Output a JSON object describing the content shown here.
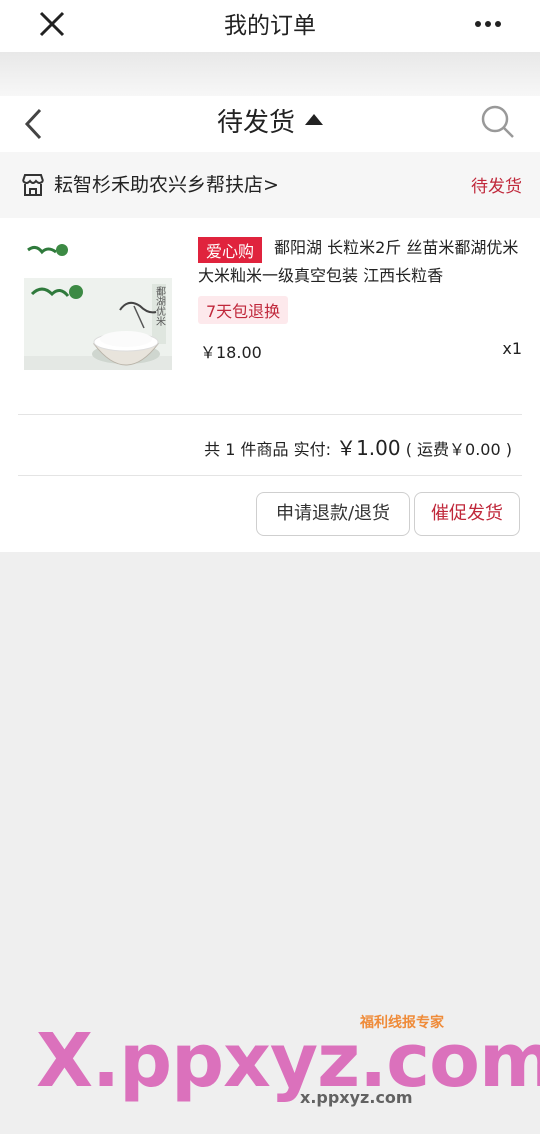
{
  "topbar": {
    "title": "我的订单"
  },
  "nav": {
    "title": "待发货"
  },
  "store": {
    "name": "耘智杉禾助农兴乡帮扶店>",
    "status": "待发货"
  },
  "product": {
    "tag": "爱心购",
    "title": "鄱阳湖 长粒米2斤 丝苗米鄱湖优米大米籼米一级真空包装 江西长粒香",
    "return_badge": "7天包退换",
    "price": "￥18.00",
    "qty": "x1",
    "package_text": "鄱湖优米"
  },
  "summary": {
    "prefix": "共 1 件商品  实付:",
    "amount": "￥1.00",
    "shipping": "( 运费￥0.00 )"
  },
  "actions": {
    "refund": "申请退款/退货",
    "urge": "催促发货"
  },
  "watermark": {
    "domain": "X.ppxyz.com",
    "brand": "福利线报专家",
    "sub": "x.ppxyz.com"
  },
  "colors": {
    "accent": "#c0283b",
    "tag_bg": "#e0233d",
    "page_bg": "#efefef"
  }
}
